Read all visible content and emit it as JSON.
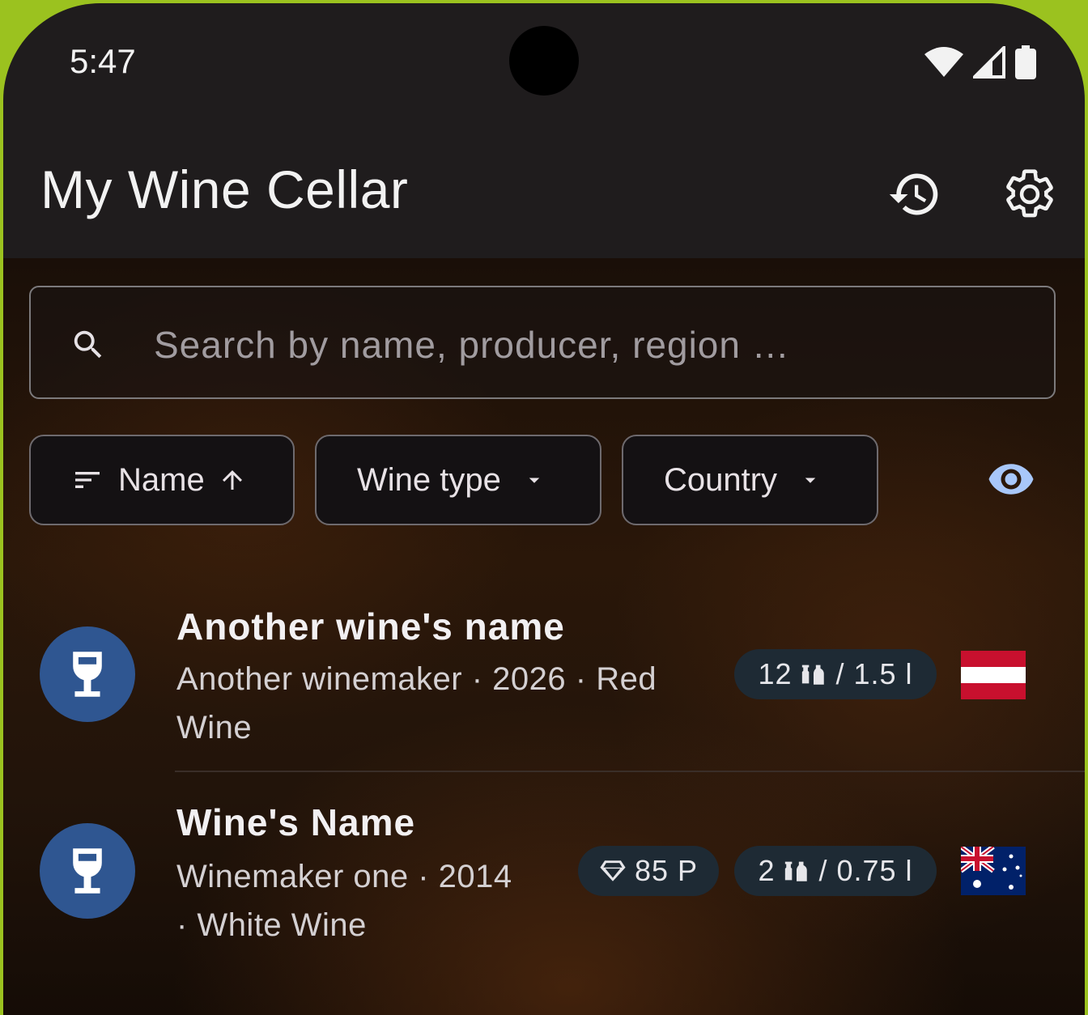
{
  "status": {
    "time": "5:47"
  },
  "app": {
    "title": "My Wine Cellar"
  },
  "search": {
    "placeholder": "Search by name, producer, region …"
  },
  "filters": {
    "sort_label": "Name",
    "wine_type_label": "Wine type",
    "country_label": "Country"
  },
  "wines": [
    {
      "name": "Another wine's name",
      "subtitle_line1": "Another winemaker · 2026 · Red",
      "subtitle_line2": "Wine",
      "bottles": "12",
      "volume": "/ 1.5 l",
      "country_flag": "austria-flag"
    },
    {
      "name": "Wine's Name",
      "subtitle_line1": "Winemaker one · 2014",
      "subtitle_line2": "· White Wine",
      "points": "85 P",
      "bottles": "2",
      "volume": "/ 0.75 l",
      "country_flag": "australia-flag"
    }
  ],
  "colors": {
    "accent": "#a8c7fa",
    "avatar_bg": "#2f5691",
    "frame": "#9bc21f"
  }
}
